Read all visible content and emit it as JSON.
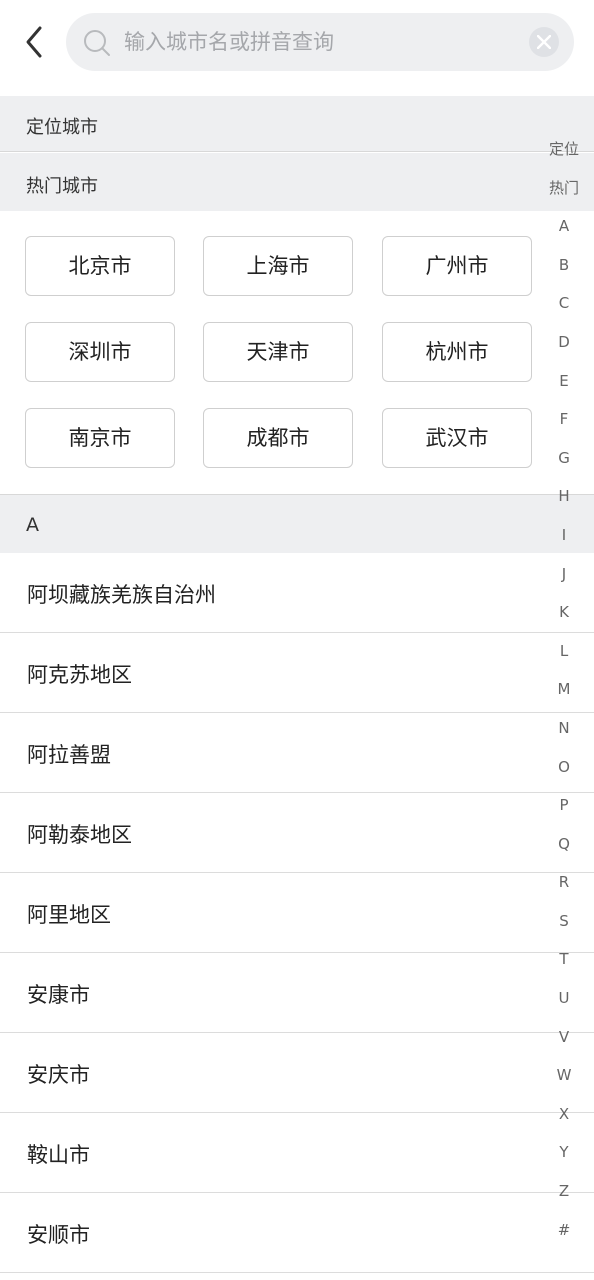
{
  "header": {
    "back_icon": "chevron-left-icon",
    "search_placeholder": "输入城市名或拼音查询",
    "search_icon": "search-icon",
    "clear_icon": "clear-icon"
  },
  "sections": {
    "location_title": "定位城市",
    "hot_title": "热门城市",
    "a_title": "A"
  },
  "hot_cities": [
    "北京市",
    "上海市",
    "广州市",
    "深圳市",
    "天津市",
    "杭州市",
    "南京市",
    "成都市",
    "武汉市"
  ],
  "city_list": [
    "阿坝藏族羌族自治州",
    "阿克苏地区",
    "阿拉善盟",
    "阿勒泰地区",
    "阿里地区",
    "安康市",
    "安庆市",
    "鞍山市",
    "安顺市"
  ],
  "index_bar": [
    "定位",
    "热门",
    "A",
    "B",
    "C",
    "D",
    "E",
    "F",
    "G",
    "H",
    "I",
    "J",
    "K",
    "L",
    "M",
    "N",
    "O",
    "P",
    "Q",
    "R",
    "S",
    "T",
    "U",
    "V",
    "W",
    "X",
    "Y",
    "Z",
    "#"
  ],
  "colors": {
    "section_bg": "#eeeff1",
    "search_bg": "#eeeff1",
    "border": "#cfcfcf",
    "placeholder": "#a5a7ab"
  }
}
